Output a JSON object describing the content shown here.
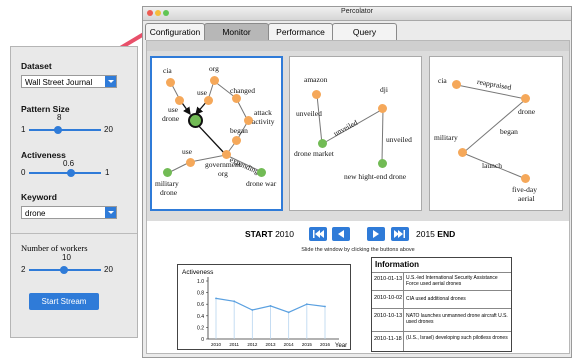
{
  "window": {
    "title": "Percolator"
  },
  "tabs": [
    {
      "label": "Configuration"
    },
    {
      "label": "Monitor"
    },
    {
      "label": "Performance"
    },
    {
      "label": "Query"
    }
  ],
  "sidebar": {
    "dataset_label": "Dataset",
    "dataset_value": "Wall Street Journal",
    "pattern_label": "Pattern Size",
    "pattern_value": "8",
    "pattern_min": "1",
    "pattern_max": "20",
    "activeness_label": "Activeness",
    "activeness_value": "0.6",
    "activeness_min": "0",
    "activeness_max": "1",
    "keyword_label": "Keyword",
    "keyword_value": "drone",
    "workers_label": "Number of workers",
    "workers_value": "10",
    "workers_min": "2",
    "workers_max": "20",
    "start_button": "Start Stream"
  },
  "graph1": {
    "nodes": {
      "cia": "cia",
      "org": "org",
      "use1": "use",
      "use2": "use",
      "changed": "changed",
      "attack": "attack",
      "activity": "activity",
      "drone": "drone",
      "began": "began",
      "use3": "use",
      "government": "government",
      "org2": "org",
      "military": "military",
      "drone2": "drone",
      "drone_war": "drone war"
    },
    "edge_label": "expanding"
  },
  "graph2": {
    "nodes": {
      "amazon": "amazon",
      "dji": "dji",
      "unveiled1": "unveiled",
      "unveiled3": "unveiled",
      "drone_market": "drone market",
      "new_drone": "new hight-end drone"
    },
    "edge_label": "unveiled"
  },
  "graph3": {
    "nodes": {
      "cia": "cia",
      "drone": "drone",
      "began": "began",
      "military": "military",
      "launch": "launch",
      "five_day": "five-day",
      "aerial": "aerial"
    },
    "edge_label": "reappraised"
  },
  "timeline": {
    "start_label": "START",
    "start_year": "2010",
    "end_year": "2015",
    "end_label": "END",
    "hint": "Slide the window by clicking the buttons above"
  },
  "chart_data": {
    "type": "line",
    "title": "Activeness",
    "xlabel": "Year",
    "categories": [
      "2010",
      "2011",
      "2012",
      "2013",
      "2014",
      "2015",
      "2016"
    ],
    "values": [
      0.7,
      0.65,
      0.5,
      0.57,
      0.46,
      0.6,
      0.56
    ],
    "yticks": [
      "0",
      "0.2",
      "0.4",
      "0.6",
      "0.8",
      "1.0"
    ],
    "ylim": [
      0,
      1.0
    ]
  },
  "info": {
    "header": "Information",
    "rows": [
      {
        "date": "2010-01-13",
        "desc": "U.S.-led International Security Assistance Force used aerial drones"
      },
      {
        "date": "2010-10-02",
        "desc": "CIA used additional drones"
      },
      {
        "date": "2010-10-13",
        "desc": "NATO launches unmanned drone aircraft U.S. used drones"
      },
      {
        "date": "2010-11-18",
        "desc": "(U.S., Israel) developing such pilotless drones"
      }
    ]
  },
  "colors": {
    "accent": "#2f7bd8",
    "node_orange": "#f5a85a",
    "node_green": "#72bb55",
    "arrow": "#e8506a"
  }
}
